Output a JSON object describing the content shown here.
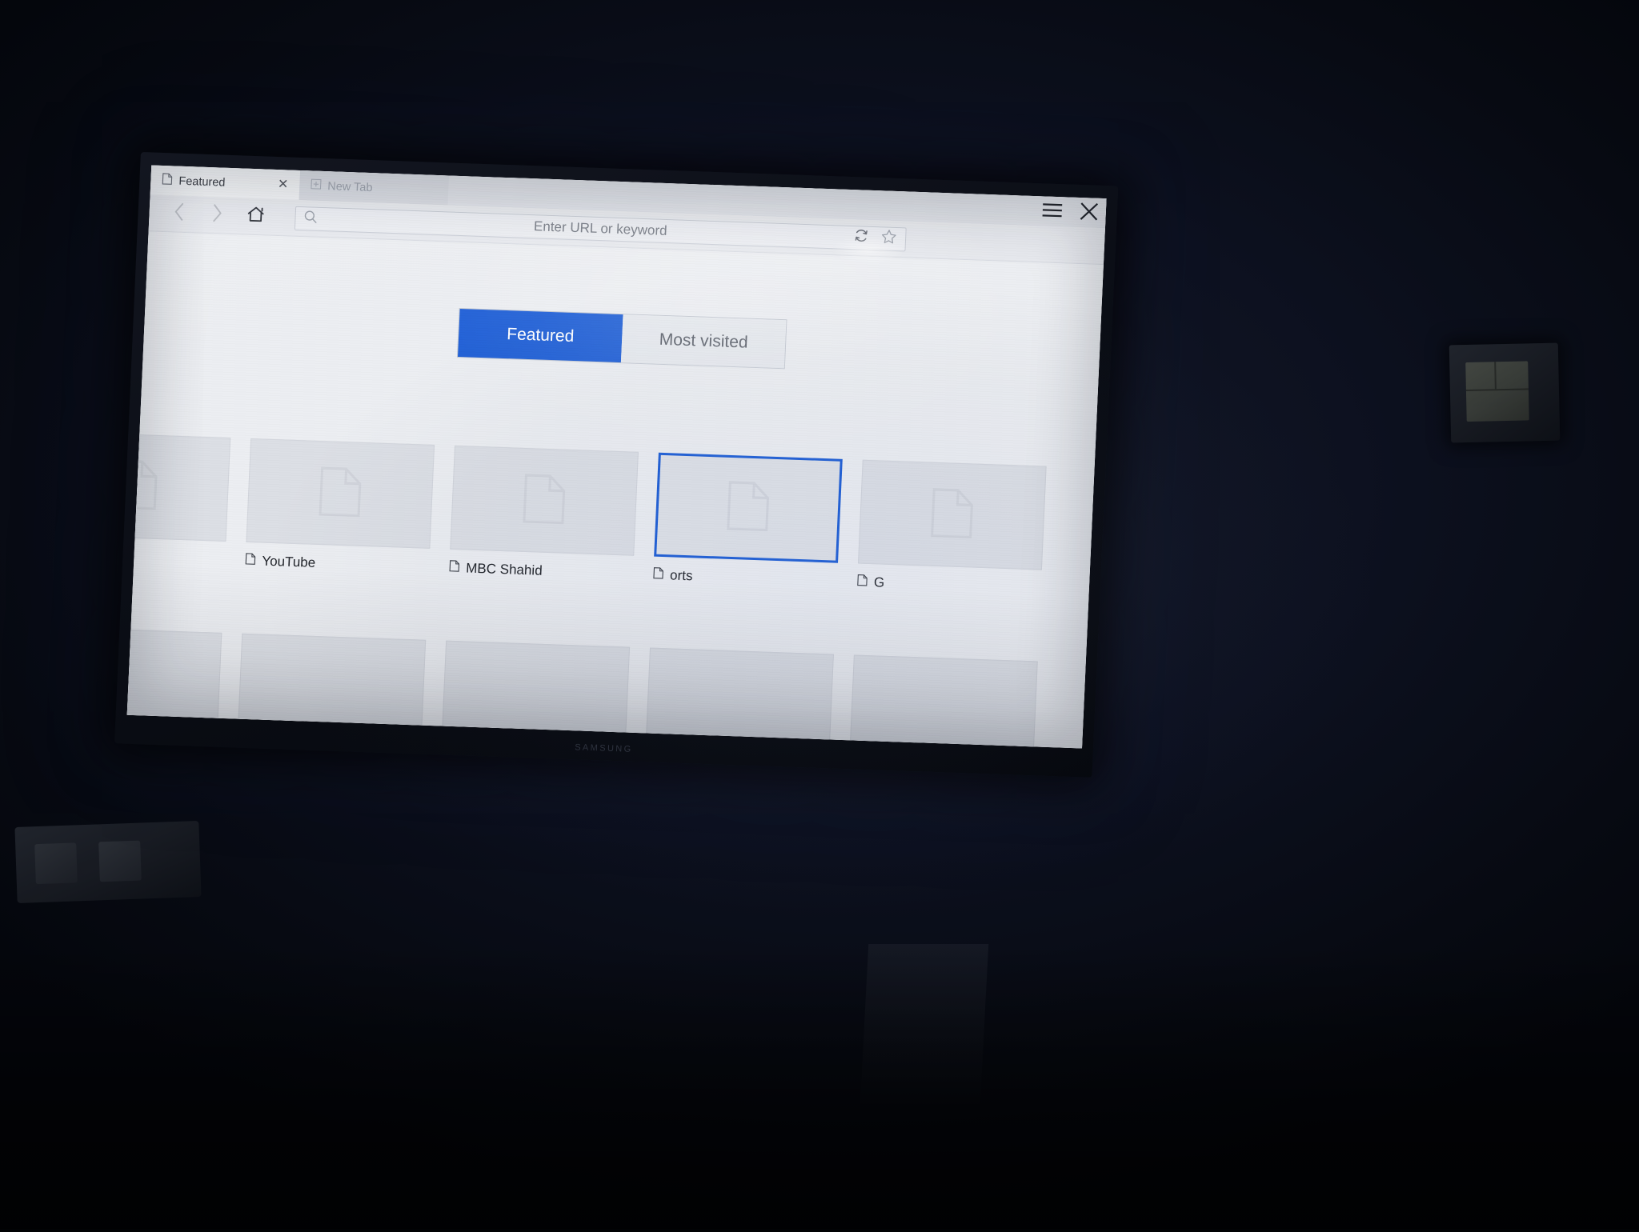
{
  "device": {
    "brand_logo": "SAMSUNG"
  },
  "browser": {
    "tabs": [
      {
        "label": "Featured",
        "icon": "page-icon",
        "close_glyph": "✕",
        "state": "active"
      },
      {
        "label": "New Tab",
        "icon": "new-tab-plus-icon",
        "state": "inactive"
      }
    ],
    "window_controls": {
      "menu_icon": "hamburger-menu-icon",
      "close_icon": "close-icon"
    },
    "toolbar": {
      "back_icon": "chevron-left-icon",
      "forward_icon": "chevron-right-icon",
      "home_icon": "home-icon",
      "search_icon": "search-icon",
      "refresh_icon": "refresh-icon",
      "bookmark_icon": "star-icon"
    },
    "address_bar": {
      "value": "",
      "placeholder": "Enter URL or keyword"
    }
  },
  "home_page": {
    "segmented_control": {
      "options": [
        {
          "label": "Featured",
          "selected": true
        },
        {
          "label": "Most visited",
          "selected": false
        }
      ]
    },
    "tiles_row1": [
      {
        "label": "",
        "icon": "page-icon",
        "selected": false,
        "clipped": true
      },
      {
        "label": "YouTube",
        "icon": "page-icon",
        "selected": false
      },
      {
        "label": "MBC Shahid",
        "icon": "page-icon",
        "selected": false
      },
      {
        "label": "orts",
        "icon": "page-icon",
        "selected": true
      },
      {
        "label": "G",
        "icon": "page-icon",
        "selected": false,
        "clipped": true
      }
    ],
    "tiles_row2": [
      {
        "label": ""
      },
      {
        "label": ""
      },
      {
        "label": ""
      },
      {
        "label": ""
      },
      {
        "label": ""
      }
    ]
  },
  "colors": {
    "accent_blue": "#1f5fd6",
    "tab_active_bg": "#f2f4f7",
    "tab_inactive_bg": "#d9dce3",
    "content_bg": "#eceef2",
    "tile_bg": "#dcdfe5",
    "text_primary": "#23262c",
    "text_muted": "#767b85"
  }
}
